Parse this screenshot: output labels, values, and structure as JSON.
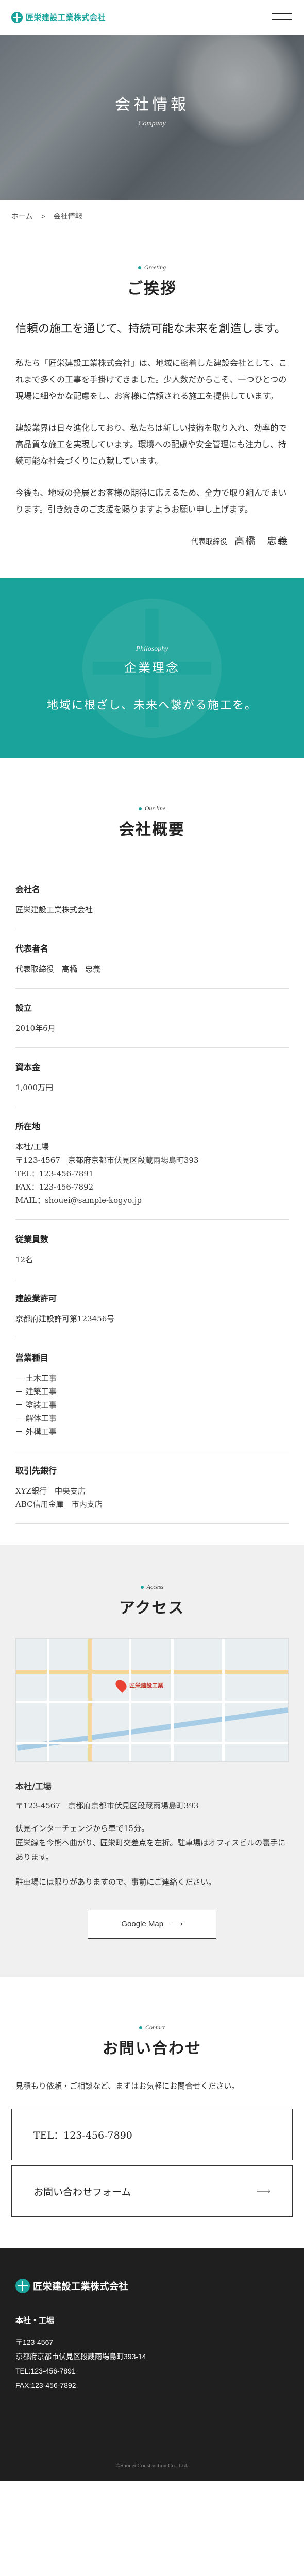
{
  "header": {
    "company_name": "匠栄建設工業株式会社",
    "menu_icon": "hamburger-icon"
  },
  "hero": {
    "title": "会社情報",
    "subtitle": "Company"
  },
  "breadcrumb": {
    "home": "ホーム",
    "separator": ">",
    "current": "会社情報"
  },
  "greeting": {
    "en": "Greeting",
    "jp": "ご挨拶",
    "lead": "信頼の施工を通じて、持続可能な未来を創造します。",
    "paragraphs": [
      "私たち「匠栄建設工業株式会社」は、地域に密着した建設会社として、これまで多くの工事を手掛けてきました。少人数だからこそ、一つひとつの現場に細やかな配慮をし、お客様に信頼される施工を提供しています。",
      "建設業界は日々進化しており、私たちは新しい技術を取り入れ、効率的で高品質な施工を実現しています。環境への配慮や安全管理にも注力し、持続可能な社会づくりに貢献しています。",
      "今後も、地域の発展とお客様の期待に応えるため、全力で取り組んでまいります。引き続きのご支援を賜りますようお願い申し上げます。"
    ],
    "signature_title": "代表取締役",
    "signature_name": "高橋　忠義"
  },
  "philosophy": {
    "en": "Philosophy",
    "jp": "企業理念",
    "text": "地域に根ざし、未来へ繋がる施工を。"
  },
  "outline": {
    "en": "Our line",
    "jp": "会社概要",
    "rows": [
      {
        "key": "会社名",
        "lines": [
          "匠栄建設工業株式会社"
        ]
      },
      {
        "key": "代表者名",
        "lines": [
          "代表取締役　高橋　忠義"
        ]
      },
      {
        "key": "設立",
        "lines": [
          "2010年6月"
        ]
      },
      {
        "key": "資本金",
        "lines": [
          "1,000万円"
        ]
      },
      {
        "key": "所在地",
        "lines": [
          "本社/工場",
          "〒123-4567　京都府京都市伏見区段蔵雨場島町393",
          "TEL：123-456-7891",
          "FAX：123-456-7892",
          "MAIL：shouei@sample-kogyo.jp"
        ]
      },
      {
        "key": "従業員数",
        "lines": [
          "12名"
        ]
      },
      {
        "key": "建設業許可",
        "lines": [
          "京都府建設許可第123456号"
        ]
      },
      {
        "key": "営業種目",
        "bullets": [
          "土木工事",
          "建築工事",
          "塗装工事",
          "解体工事",
          "外構工事"
        ]
      },
      {
        "key": "取引先銀行",
        "lines": [
          "XYZ銀行　中央支店",
          "ABC信用金庫　市内支店"
        ]
      }
    ]
  },
  "access": {
    "en": "Access",
    "jp": "アクセス",
    "map_label": "匠栄建設工業",
    "office": "本社/工場",
    "address": "〒123-4567　京都府京都市伏見区段蔵雨場島町393",
    "notes": [
      "伏見インターチェンジから車で15分。",
      "匠栄線を今熊へ曲がり、匠栄町交差点を左折。駐車場はオフィスビルの裏手にあります。",
      "駐車場には限りがありますので、事前にご連絡ください。"
    ],
    "map_button": "Google Map",
    "arrow": "⟶"
  },
  "contact": {
    "en": "Contact",
    "jp": "お問い合わせ",
    "note": "見積もり依頼・ご相談など、まずはお気軽にお問合せください。",
    "tel": "TEL：123-456-7890",
    "form": "お問い合わせフォーム",
    "arrow": "⟶"
  },
  "footer": {
    "company_name": "匠栄建設工業株式会社",
    "office": "本社・工場",
    "lines": [
      "〒123-4567",
      "京都府京都市伏見区段蔵雨場島町393-14",
      "TEL:123-456-7891",
      "FAX:123-456-7892"
    ],
    "copyright": "©Shouei Construction Co., Ltd."
  }
}
